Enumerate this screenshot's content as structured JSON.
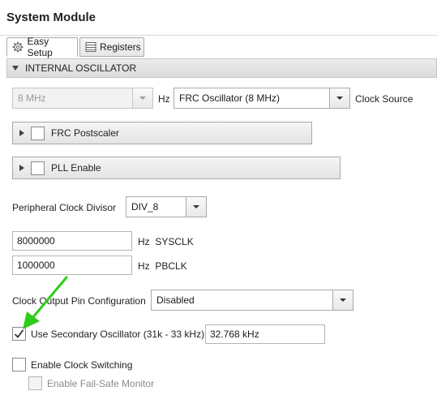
{
  "window": {
    "title": "System Module"
  },
  "tabs": [
    {
      "label": "Easy Setup",
      "icon": "gear-icon",
      "active": true
    },
    {
      "label": "Registers",
      "icon": "register-table-icon",
      "active": false
    }
  ],
  "section": {
    "title": "INTERNAL OSCILLATOR"
  },
  "oscillator": {
    "frequency_value": "8 MHz",
    "frequency_unit": "Hz",
    "clock_source_value": "FRC Oscillator (8 MHz)",
    "clock_source_label": "Clock Source"
  },
  "frc_postscaler": {
    "label": "FRC Postscaler",
    "checked": false
  },
  "pll_enable": {
    "label": "PLL Enable",
    "checked": false
  },
  "peripheral_divisor": {
    "label": "Peripheral Clock Divisor",
    "value": "DIV_8"
  },
  "sysclk": {
    "value": "8000000",
    "unit": "Hz",
    "label": "SYSCLK"
  },
  "pbclk": {
    "value": "1000000",
    "unit": "Hz",
    "label": "PBCLK"
  },
  "clock_output": {
    "label": "Clock Output Pin Configuration",
    "value": "Disabled"
  },
  "secondary_osc": {
    "label": "Use Secondary Oscillator (31k - 33 kHz)",
    "checked": true,
    "value": "32.768 kHz"
  },
  "clock_switching": {
    "label": "Enable Clock Switching",
    "checked": false
  },
  "fail_safe": {
    "label": "Enable Fail-Safe Monitor",
    "checked": false,
    "disabled": true
  },
  "colors": {
    "arrow_annotation": "#2ecc1a",
    "border": "#a9a9a9",
    "section_bg": "#e4e4e4"
  }
}
